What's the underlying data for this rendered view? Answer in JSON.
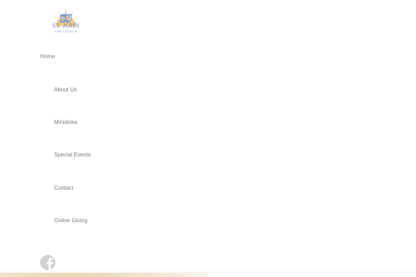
{
  "logo": {
    "monogram": "SJ",
    "name": "ST. JOHN",
    "subtitle": "CME CHURCH",
    "colors": {
      "sunburst": "#f2c477",
      "letters": "#7b93c6"
    }
  },
  "nav": {
    "items": [
      {
        "label": "Home"
      },
      {
        "label": "About Us"
      },
      {
        "label": "Ministries"
      },
      {
        "label": "Special Events"
      },
      {
        "label": "Contact"
      },
      {
        "label": "Online Giving"
      }
    ]
  },
  "social": {
    "facebook_icon": "facebook-icon",
    "color": "#d2d2d2"
  }
}
